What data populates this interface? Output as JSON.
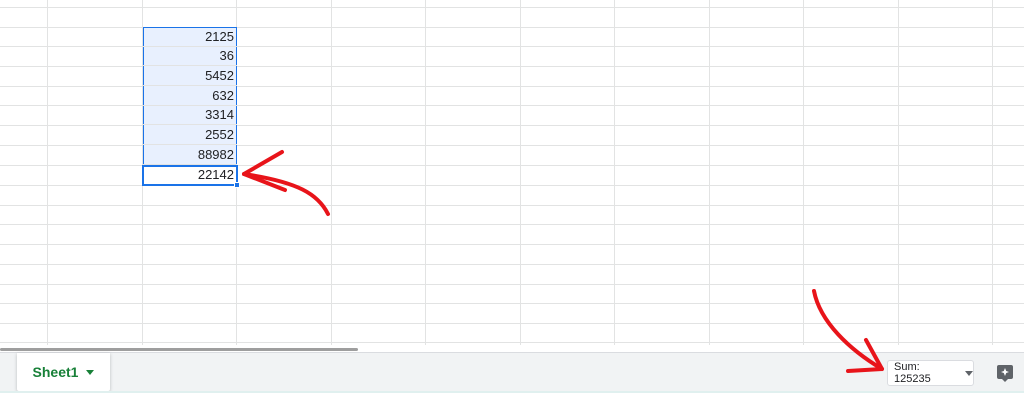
{
  "grid": {
    "selected_values": [
      "2125",
      "36",
      "5452",
      "632",
      "3314",
      "2552",
      "88982",
      "22142"
    ]
  },
  "bottom_bar": {
    "sheet_tab_label": "Sheet1",
    "sum_label": "Sum: 125235"
  },
  "icons": {
    "sheet_menu": "caret-down-icon",
    "sum_menu": "caret-down-icon",
    "explore": "explore-icon"
  },
  "colors": {
    "selection_fill": "#e8f0fe",
    "selection_border": "#1a73e8",
    "sheet_tab_text": "#188038",
    "annotation_arrow": "#e8141a"
  }
}
